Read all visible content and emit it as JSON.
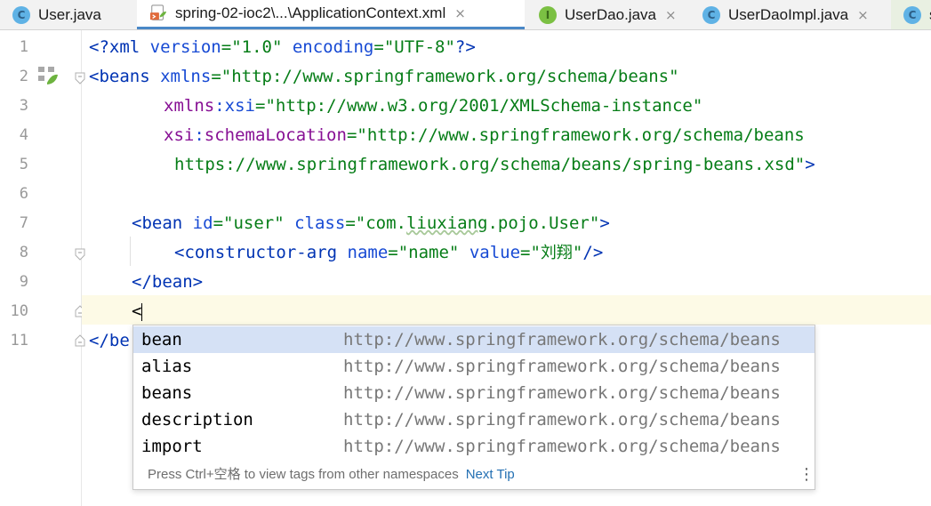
{
  "tabs": [
    {
      "label": "User.java",
      "icon": "java-class-icon",
      "icon_letter": "C",
      "active": false,
      "closable": true
    },
    {
      "label": "spring-02-ioc2\\...\\ApplicationContext.xml",
      "icon": "spring-xml-icon",
      "active": true,
      "closable": true
    },
    {
      "label": "UserDao.java",
      "icon": "java-interface-icon",
      "icon_letter": "I",
      "active": false,
      "closable": true
    },
    {
      "label": "UserDaoImpl.java",
      "icon": "java-class-icon",
      "icon_letter": "C",
      "active": false,
      "closable": true
    },
    {
      "label": "s",
      "icon": "java-class-run-icon",
      "icon_letter": "C",
      "active": false,
      "closable": false
    }
  ],
  "tab_close_glyph": "×",
  "line_numbers": [
    "1",
    "2",
    "3",
    "4",
    "5",
    "6",
    "7",
    "8",
    "9",
    "10",
    "11"
  ],
  "code": {
    "l1": {
      "a": "<?",
      "b": "xml",
      "c": " ",
      "d": "version",
      "e": "=",
      "f": "\"1.0\"",
      "g": " ",
      "h": "encoding",
      "i": "=",
      "j": "\"UTF-8\"",
      "k": "?>"
    },
    "l2": {
      "a": "<",
      "b": "beans",
      "c": " ",
      "d": "xmlns",
      "e": "=",
      "f": "\"http://www.springframework.org/schema/beans\""
    },
    "l3": {
      "a": "xmlns",
      "b": ":",
      "c": "xsi",
      "d": "=",
      "e": "\"http://www.w3.org/2001/XMLSchema-instance\""
    },
    "l4": {
      "a": "xsi",
      "b": ":",
      "c": "schemaLocation",
      "d": "=",
      "e": "\"http://www.springframework.org/schema/beans"
    },
    "l5": {
      "a": "https://www.springframework.org/schema/beans/spring-beans.xsd\"",
      "b": ">"
    },
    "l7": {
      "a": "<",
      "b": "bean",
      "c": " ",
      "d": "id",
      "e": "=",
      "f": "\"user\"",
      "g": " ",
      "h": "class",
      "i": "=",
      "j": "\"com.",
      "k": "liuxiang",
      "l": ".pojo.User\"",
      "m": ">"
    },
    "l8": {
      "a": "<",
      "b": "constructor-arg",
      "c": " ",
      "d": "name",
      "e": "=",
      "f": "\"name\"",
      "g": " ",
      "h": "value",
      "i": "=",
      "j": "\"",
      "k": "刘翔",
      "l": "\"",
      "m": "/>"
    },
    "l9": {
      "a": "</",
      "b": "bean",
      "c": ">"
    },
    "l10": {
      "a": "<"
    },
    "l11": {
      "a": "</",
      "b": "be"
    }
  },
  "completion": {
    "items": [
      {
        "name": "bean",
        "namespace": "http://www.springframework.org/schema/beans",
        "selected": true
      },
      {
        "name": "alias",
        "namespace": "http://www.springframework.org/schema/beans",
        "selected": false
      },
      {
        "name": "beans",
        "namespace": "http://www.springframework.org/schema/beans",
        "selected": false
      },
      {
        "name": "description",
        "namespace": "http://www.springframework.org/schema/beans",
        "selected": false
      },
      {
        "name": "import",
        "namespace": "http://www.springframework.org/schema/beans",
        "selected": false
      }
    ],
    "footer_hint": "Press Ctrl+空格 to view tags from other namespaces",
    "next_tip_label": "Next Tip",
    "more_glyph": "⋮"
  },
  "colors": {
    "tag": "#0033b3",
    "attribute": "#174ad4",
    "namespace_prefix": "#871094",
    "string_value": "#067d17",
    "current_line": "#fdfae6",
    "selected_item": "#d5e1f5",
    "active_tab_underline": "#4a88c7"
  }
}
